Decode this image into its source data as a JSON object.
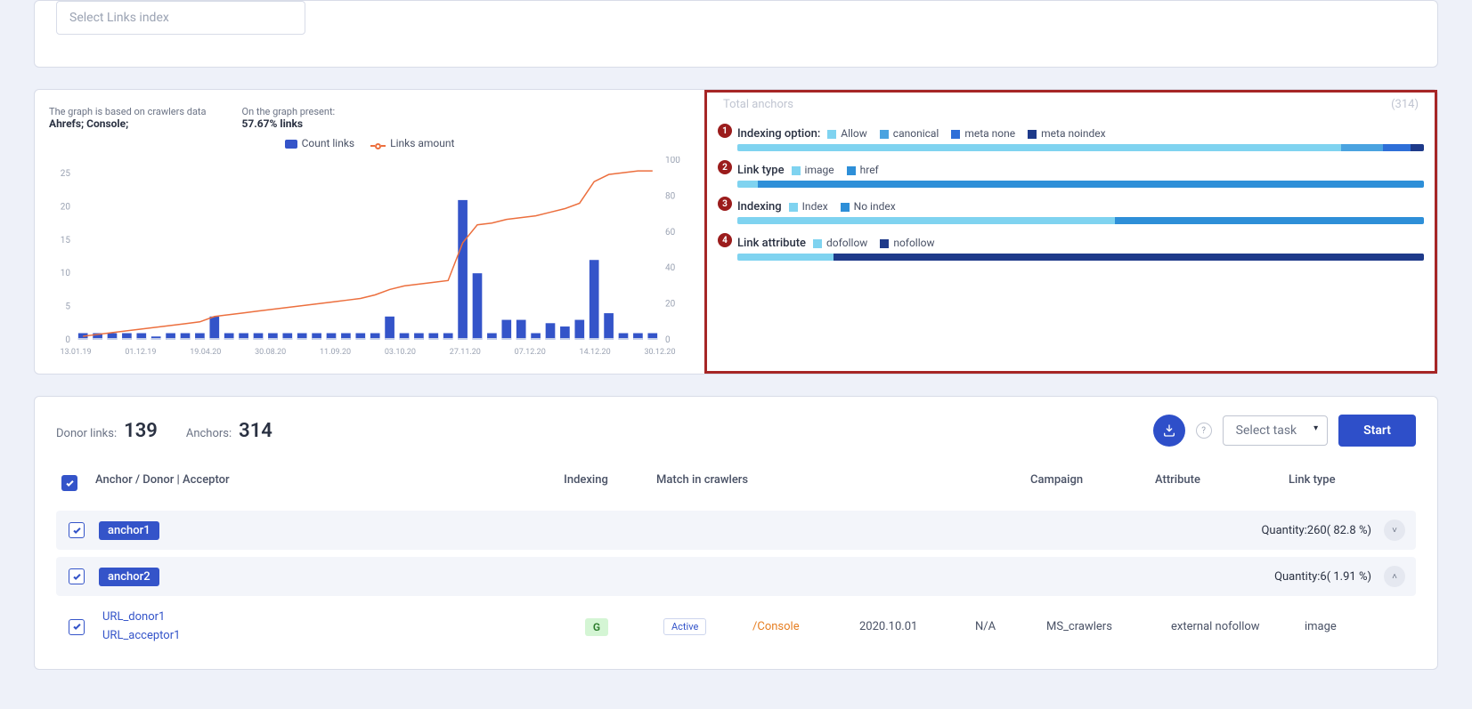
{
  "top_select_placeholder": "Select Links index",
  "meta": {
    "label1": "The graph is based on crawlers data",
    "value1": "Ahrefs; Console;",
    "label2": "On the graph present:",
    "value2": "57.67% links"
  },
  "legend": {
    "bars": "Count links",
    "line": "Links amount"
  },
  "right": {
    "total_label": "Total anchors",
    "total_value": "(314)",
    "metrics": [
      {
        "n": "1",
        "label": "Indexing option:",
        "items": [
          "Allow",
          "canonical",
          "meta none",
          "meta noindex"
        ],
        "seg": [
          88,
          6,
          4,
          2
        ],
        "cols": [
          "#7fd3f0",
          "#4aa3e0",
          "#2e6fd8",
          "#1e3a8a"
        ]
      },
      {
        "n": "2",
        "label": "Link type",
        "items": [
          "image",
          "href"
        ],
        "seg": [
          3,
          97
        ],
        "cols": [
          "#7fd3f0",
          "#2e8fd8"
        ]
      },
      {
        "n": "3",
        "label": "Indexing",
        "items": [
          "Index",
          "No index"
        ],
        "seg": [
          55,
          45
        ],
        "cols": [
          "#7fd3f0",
          "#2e8fd8"
        ]
      },
      {
        "n": "4",
        "label": "Link attribute",
        "items": [
          "dofollow",
          "nofollow"
        ],
        "seg": [
          14,
          86
        ],
        "cols": [
          "#7fd3f0",
          "#1e3a8a"
        ]
      }
    ]
  },
  "stats": {
    "donor_label": "Donor links:",
    "donor": "139",
    "anchor_label": "Anchors:",
    "anchor": "314",
    "select_task": "Select task",
    "start": "Start"
  },
  "columns": [
    "Anchor / Donor | Acceptor",
    "Indexing",
    "Match in crawlers",
    "Campaign",
    "Attribute",
    "Link type"
  ],
  "groups": [
    {
      "name": "anchor1",
      "qty": "Quantity:260( 82.8 %)",
      "open": false
    },
    {
      "name": "anchor2",
      "qty": "Quantity:6( 1.91 %)",
      "open": true
    }
  ],
  "row": {
    "url1": "URL_donor1",
    "url2": "URL_acceptor1",
    "g": "G",
    "status": "Active",
    "console": "/Console",
    "date": "2020.10.01",
    "na": "N/A",
    "campaign": "MS_crawlers",
    "attr": "external nofollow",
    "ltype": "image"
  },
  "chart_data": {
    "type": "bar+line",
    "x_ticks": [
      "13.01.19",
      "01.12.19",
      "19.04.20",
      "30.08.20",
      "11.09.20",
      "03.10.20",
      "27.11.20",
      "07.12.20",
      "14.12.20",
      "30.12.20"
    ],
    "left_axis": {
      "label": "Count links",
      "ticks": [
        0,
        5,
        10,
        15,
        20,
        25
      ],
      "range": [
        0,
        27
      ]
    },
    "right_axis": {
      "label": "Links amount",
      "ticks": [
        0,
        20,
        40,
        60,
        80,
        100
      ],
      "range": [
        0,
        100
      ]
    },
    "bars": [
      1,
      1,
      1,
      1,
      1,
      0.5,
      1,
      1,
      1,
      3.5,
      1,
      1,
      1,
      1,
      1,
      1,
      1,
      1,
      1,
      1,
      1,
      3.5,
      1,
      1,
      1,
      1,
      21,
      10,
      1,
      3,
      3,
      1,
      2.5,
      2,
      3,
      12,
      4,
      1,
      1,
      1
    ],
    "line": [
      2,
      3,
      4,
      5,
      6,
      7,
      8,
      9,
      10,
      13,
      14,
      15,
      16,
      17,
      18,
      19,
      20,
      21,
      22,
      23,
      25,
      28,
      30,
      31,
      32,
      33,
      54,
      64,
      65,
      67,
      68,
      69,
      71,
      73,
      76,
      88,
      92,
      93,
      94,
      94
    ]
  }
}
